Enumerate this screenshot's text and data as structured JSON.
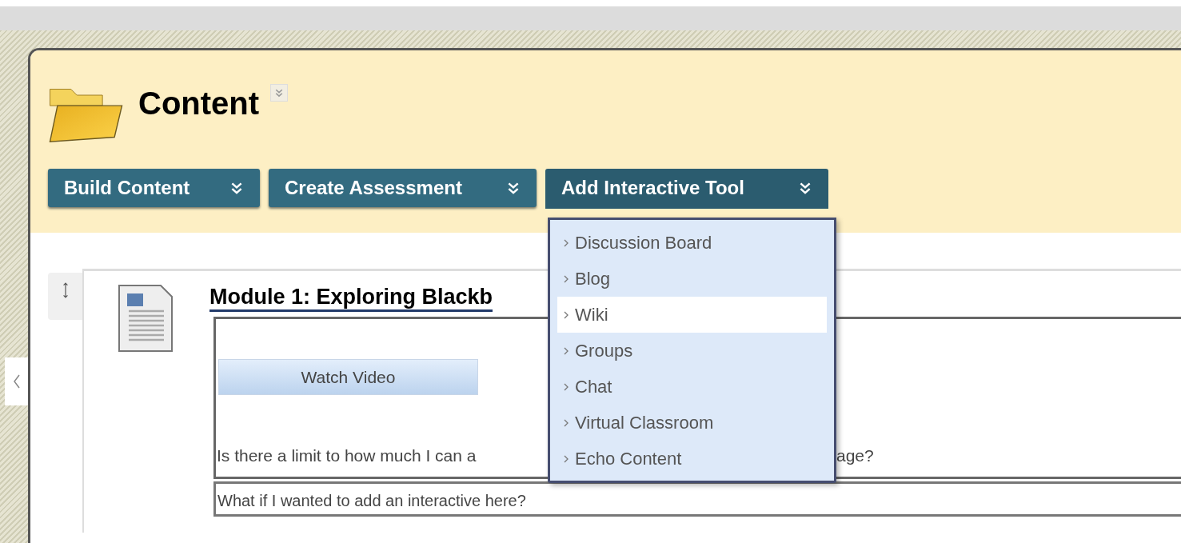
{
  "page_title": "Content",
  "action_buttons": [
    {
      "label": "Build Content",
      "expanded": false
    },
    {
      "label": "Create Assessment",
      "expanded": false
    },
    {
      "label": "Add Interactive Tool",
      "expanded": true
    }
  ],
  "dropdown_menu": {
    "items": [
      {
        "label": "Discussion Board",
        "selected": false
      },
      {
        "label": "Blog",
        "selected": false
      },
      {
        "label": "Wiki",
        "selected": true
      },
      {
        "label": "Groups",
        "selected": false
      },
      {
        "label": "Chat",
        "selected": false
      },
      {
        "label": "Virtual Classroom",
        "selected": false
      },
      {
        "label": "Echo Content",
        "selected": false
      }
    ]
  },
  "content_item": {
    "title": "Module 1: Exploring Blackb",
    "video_button": "Watch Video",
    "question_parts": [
      "Is there a limit to how much I can a",
      "age?"
    ],
    "note": "What if I wanted to add an interactive here?"
  }
}
